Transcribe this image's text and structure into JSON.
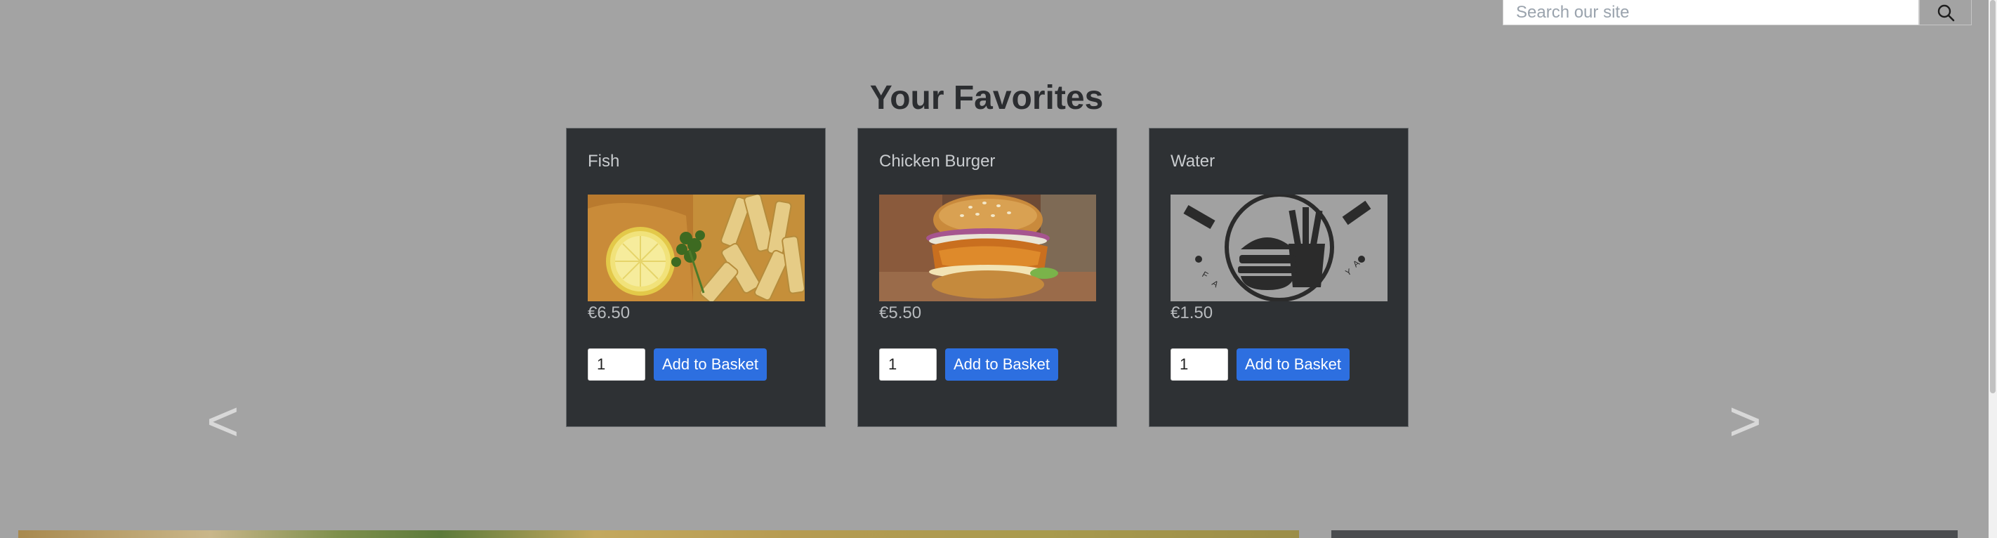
{
  "search": {
    "placeholder": "Search our site",
    "button_icon": "search-icon"
  },
  "favorites": {
    "heading": "Your Favorites",
    "prev_label": "<",
    "next_label": ">",
    "items": [
      {
        "name": "Fish",
        "price": "€6.50",
        "quantity": "1",
        "add_label": "Add to Basket",
        "image": "fish-and-chips-photo"
      },
      {
        "name": "Chicken Burger",
        "price": "€5.50",
        "quantity": "1",
        "add_label": "Add to Basket",
        "image": "chicken-burger-photo"
      },
      {
        "name": "Water",
        "price": "€1.50",
        "quantity": "1",
        "add_label": "Add to Basket",
        "image": "shop-logo-placeholder"
      }
    ]
  },
  "colors": {
    "page_background": "#a3a3a3",
    "card_background": "#2e3134",
    "button_primary": "#2d6fe0"
  }
}
